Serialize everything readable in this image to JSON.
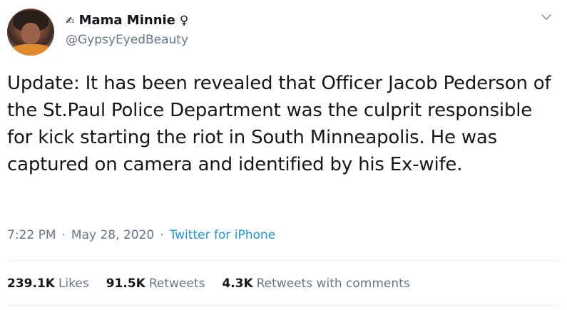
{
  "user": {
    "name_prefix": "✍",
    "display_name": "Mama Minnie",
    "name_suffix": "♀",
    "handle": "@GypsyEyedBeauty"
  },
  "tweet": {
    "text": "Update: It has been revealed that Officer Jacob Pederson of the St.Paul Police Department was the culprit responsible for kick starting the riot in South Minneapolis. He was captured on camera and identified by his Ex-wife.",
    "time": "7:22 PM",
    "separator": "·",
    "date": "May 28, 2020",
    "source": "Twitter for iPhone"
  },
  "stats": {
    "likes_count": "239.1K",
    "likes_label": "Likes",
    "retweets_count": "91.5K",
    "retweets_label": "Retweets",
    "comments_count": "4.3K",
    "comments_label": "Retweets with comments"
  },
  "icons": {
    "menu": "chevron-down-icon"
  },
  "colors": {
    "link": "#1b95e0",
    "secondary_text": "#657786",
    "primary_text": "#14171a",
    "divider": "#e6ecf0"
  }
}
